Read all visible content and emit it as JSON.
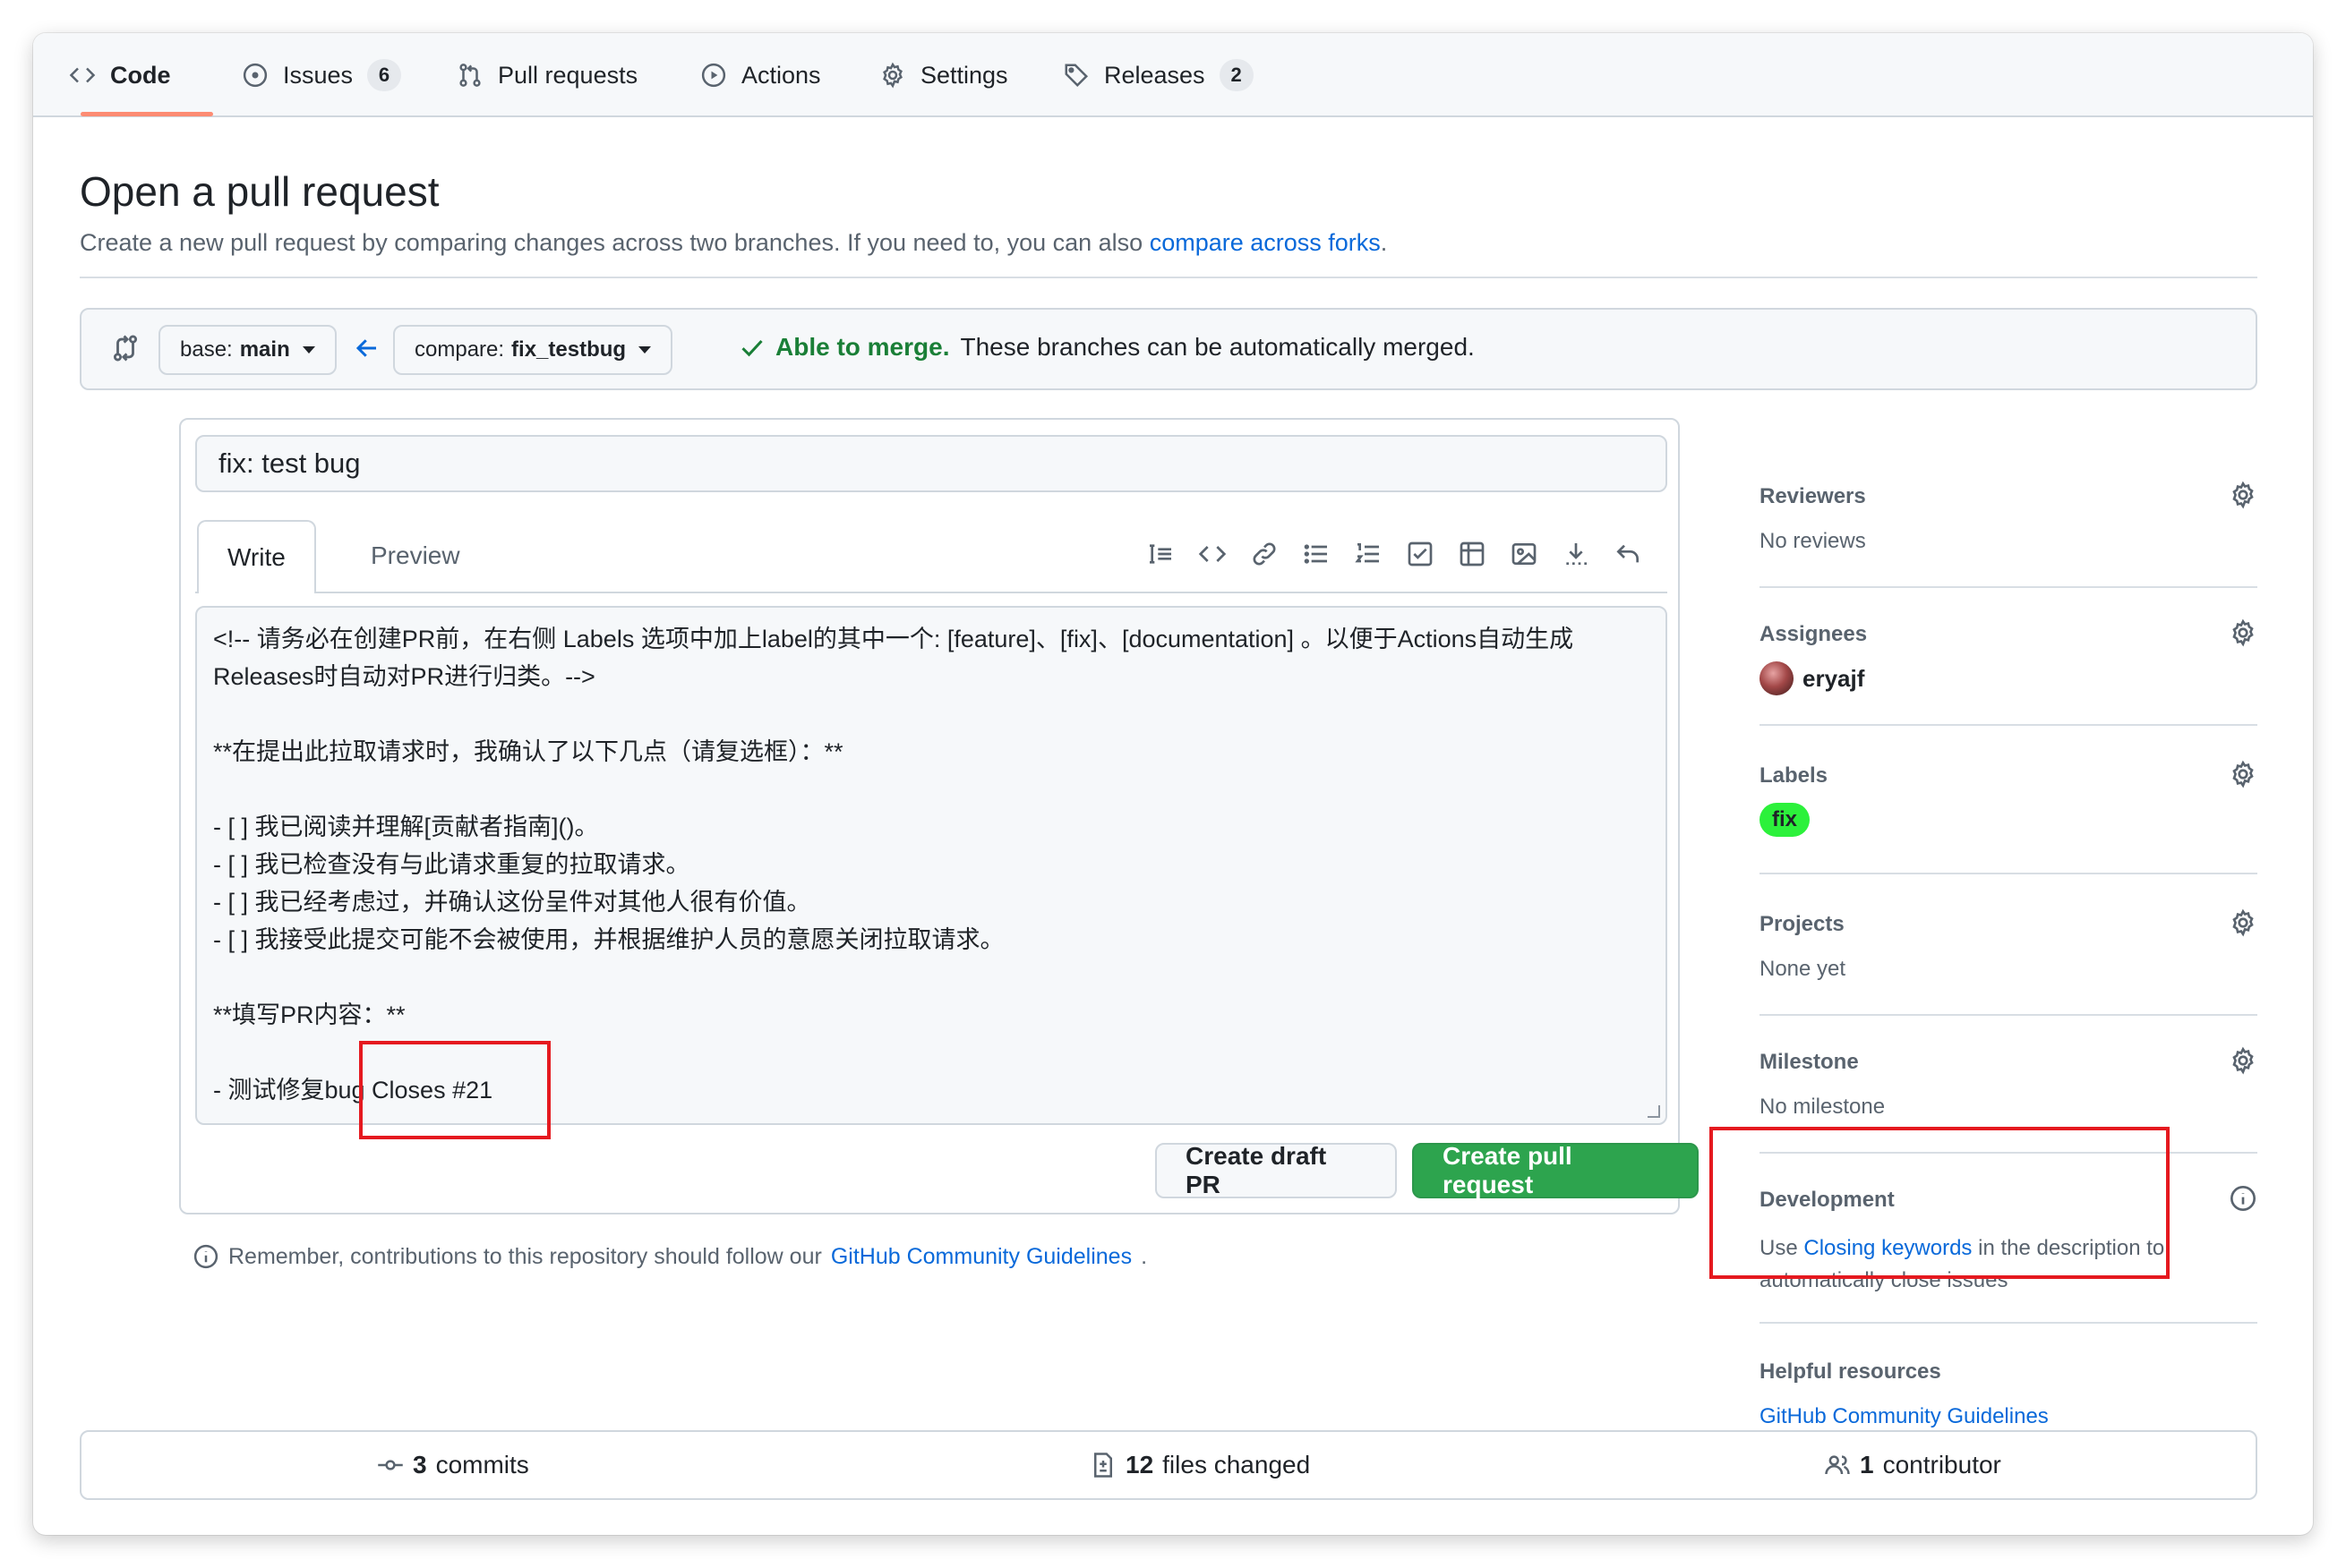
{
  "nav": {
    "tabs": [
      {
        "label": "Code",
        "icon": "code-icon",
        "selected": true
      },
      {
        "label": "Issues",
        "icon": "issue-icon",
        "count": "6"
      },
      {
        "label": "Pull requests",
        "icon": "pull-request-icon"
      },
      {
        "label": "Actions",
        "icon": "play-icon"
      },
      {
        "label": "Settings",
        "icon": "gear-icon"
      },
      {
        "label": "Releases",
        "icon": "tag-icon",
        "count": "2"
      }
    ]
  },
  "header": {
    "title": "Open a pull request",
    "subtitle_text": "Create a new pull request by comparing changes across two branches. If you need to, you can also ",
    "subtitle_link": "compare across forks",
    "subtitle_end": "."
  },
  "compare": {
    "base_prefix": "base:",
    "base_branch": "main",
    "compare_prefix": "compare:",
    "compare_branch": "fix_testbug",
    "status_bold": "Able to merge.",
    "status_text": "These branches can be automatically merged."
  },
  "editor": {
    "title_value": "fix: test bug",
    "tab_write": "Write",
    "tab_preview": "Preview",
    "toolbar_icons": [
      "heading-icon",
      "code-icon",
      "link-icon",
      "unordered-list-icon",
      "ordered-list-icon",
      "task-list-icon",
      "table-icon",
      "image-icon",
      "mention-icon",
      "undo-icon"
    ],
    "body_lines": [
      "<!-- 请务必在创建PR前，在右侧 Labels 选项中加上label的其中一个: [feature]、[fix]、[documentation] 。以便于Actions自动生成Releases时自动对PR进行归类。-->",
      "",
      "**在提出此拉取请求时，我确认了以下几点（请复选框）：**",
      "",
      "- [ ] 我已阅读并理解[贡献者指南]()。",
      "- [ ] 我已检查没有与此请求重复的拉取请求。",
      "- [ ] 我已经考虑过，并确认这份呈件对其他人很有价值。",
      "- [ ] 我接受此提交可能不会被使用，并根据维护人员的意愿关闭拉取请求。",
      "",
      "**填写PR内容：**",
      "",
      "- 测试修复bug Closes #21"
    ],
    "draft_button": "Create draft PR",
    "create_button": "Create pull request"
  },
  "remember": {
    "text": "Remember, contributions to this repository should follow our ",
    "link": "GitHub Community Guidelines",
    "end": "."
  },
  "sidebar": {
    "reviewers": {
      "title": "Reviewers",
      "value": "No reviews"
    },
    "assignees": {
      "title": "Assignees",
      "user": "eryajf"
    },
    "labels": {
      "title": "Labels",
      "label": "fix",
      "label_color": "#2cf13b"
    },
    "projects": {
      "title": "Projects",
      "value": "None yet"
    },
    "milestone": {
      "title": "Milestone",
      "value": "No milestone"
    },
    "development": {
      "title": "Development",
      "text_before": "Use ",
      "link": "Closing keywords",
      "text_after": " in the description to automatically close issues"
    },
    "resources": {
      "title": "Helpful resources",
      "link": "GitHub Community Guidelines"
    }
  },
  "summary": {
    "commits_count": "3",
    "commits_label": "commits",
    "files_count": "12",
    "files_label": "files changed",
    "contributors_count": "1",
    "contributors_label": "contributor"
  },
  "colors": {
    "accent": "#0969da",
    "primary_button": "#2da44e",
    "highlight": "#e5191f",
    "tab_underline": "#fd8c73"
  }
}
